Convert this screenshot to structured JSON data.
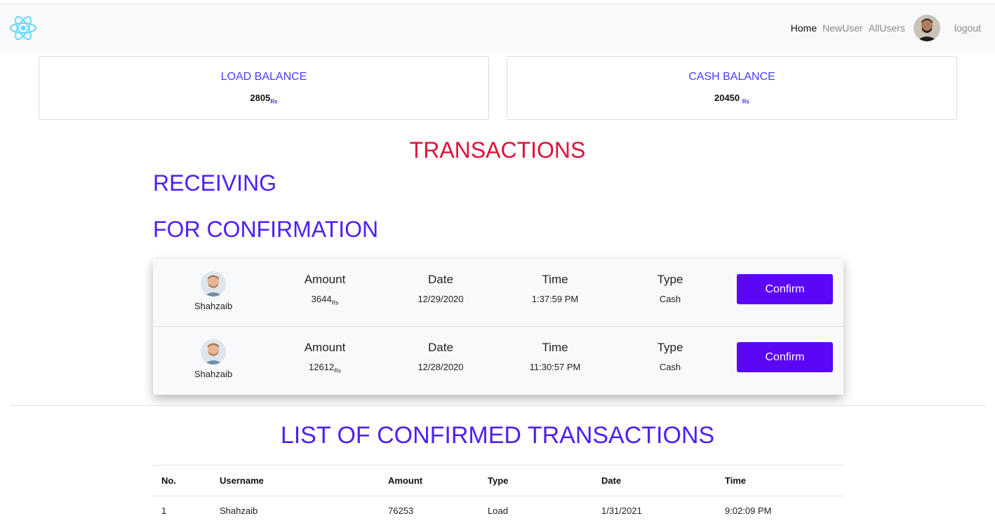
{
  "nav": {
    "links": [
      "Home",
      "NewUser",
      "AllUsers"
    ],
    "logout": "logout",
    "logo_icon": "react-atom-icon",
    "accent": "#61dafb"
  },
  "balances": {
    "load": {
      "title": "LOAD BALANCE",
      "value": "2805",
      "unit": "Rs"
    },
    "cash": {
      "title": "CASH BALANCE",
      "value": "20450",
      "unit": "Rs"
    }
  },
  "headings": {
    "transactions": "TRANSACTIONS",
    "receiving": "RECEIVING",
    "for_confirmation": "FOR CONFIRMATION",
    "confirmed_list": "LIST OF CONFIRMED TRANSACTIONS"
  },
  "pending_labels": {
    "amount": "Amount",
    "date": "Date",
    "time": "Time",
    "type": "Type",
    "confirm": "Confirm"
  },
  "pending": [
    {
      "user": "Shahzaib",
      "amount": "3644",
      "unit": "Rs",
      "date": "12/29/2020",
      "time": "1:37:59 PM",
      "type": "Cash"
    },
    {
      "user": "Shahzaib",
      "amount": "12612",
      "unit": "Rs",
      "date": "12/28/2020",
      "time": "11:30:57 PM",
      "type": "Cash"
    }
  ],
  "confirmed_table": {
    "headers": [
      "No.",
      "Username",
      "Amount",
      "Type",
      "Date",
      "Time"
    ],
    "rows": [
      [
        "1",
        "Shahzaib",
        "76253",
        "Load",
        "1/31/2021",
        "9:02:09 PM"
      ]
    ]
  },
  "colors": {
    "primary": "#5b06f5",
    "heading_red": "#e0103a",
    "heading_blue": "#4f1ff5"
  }
}
